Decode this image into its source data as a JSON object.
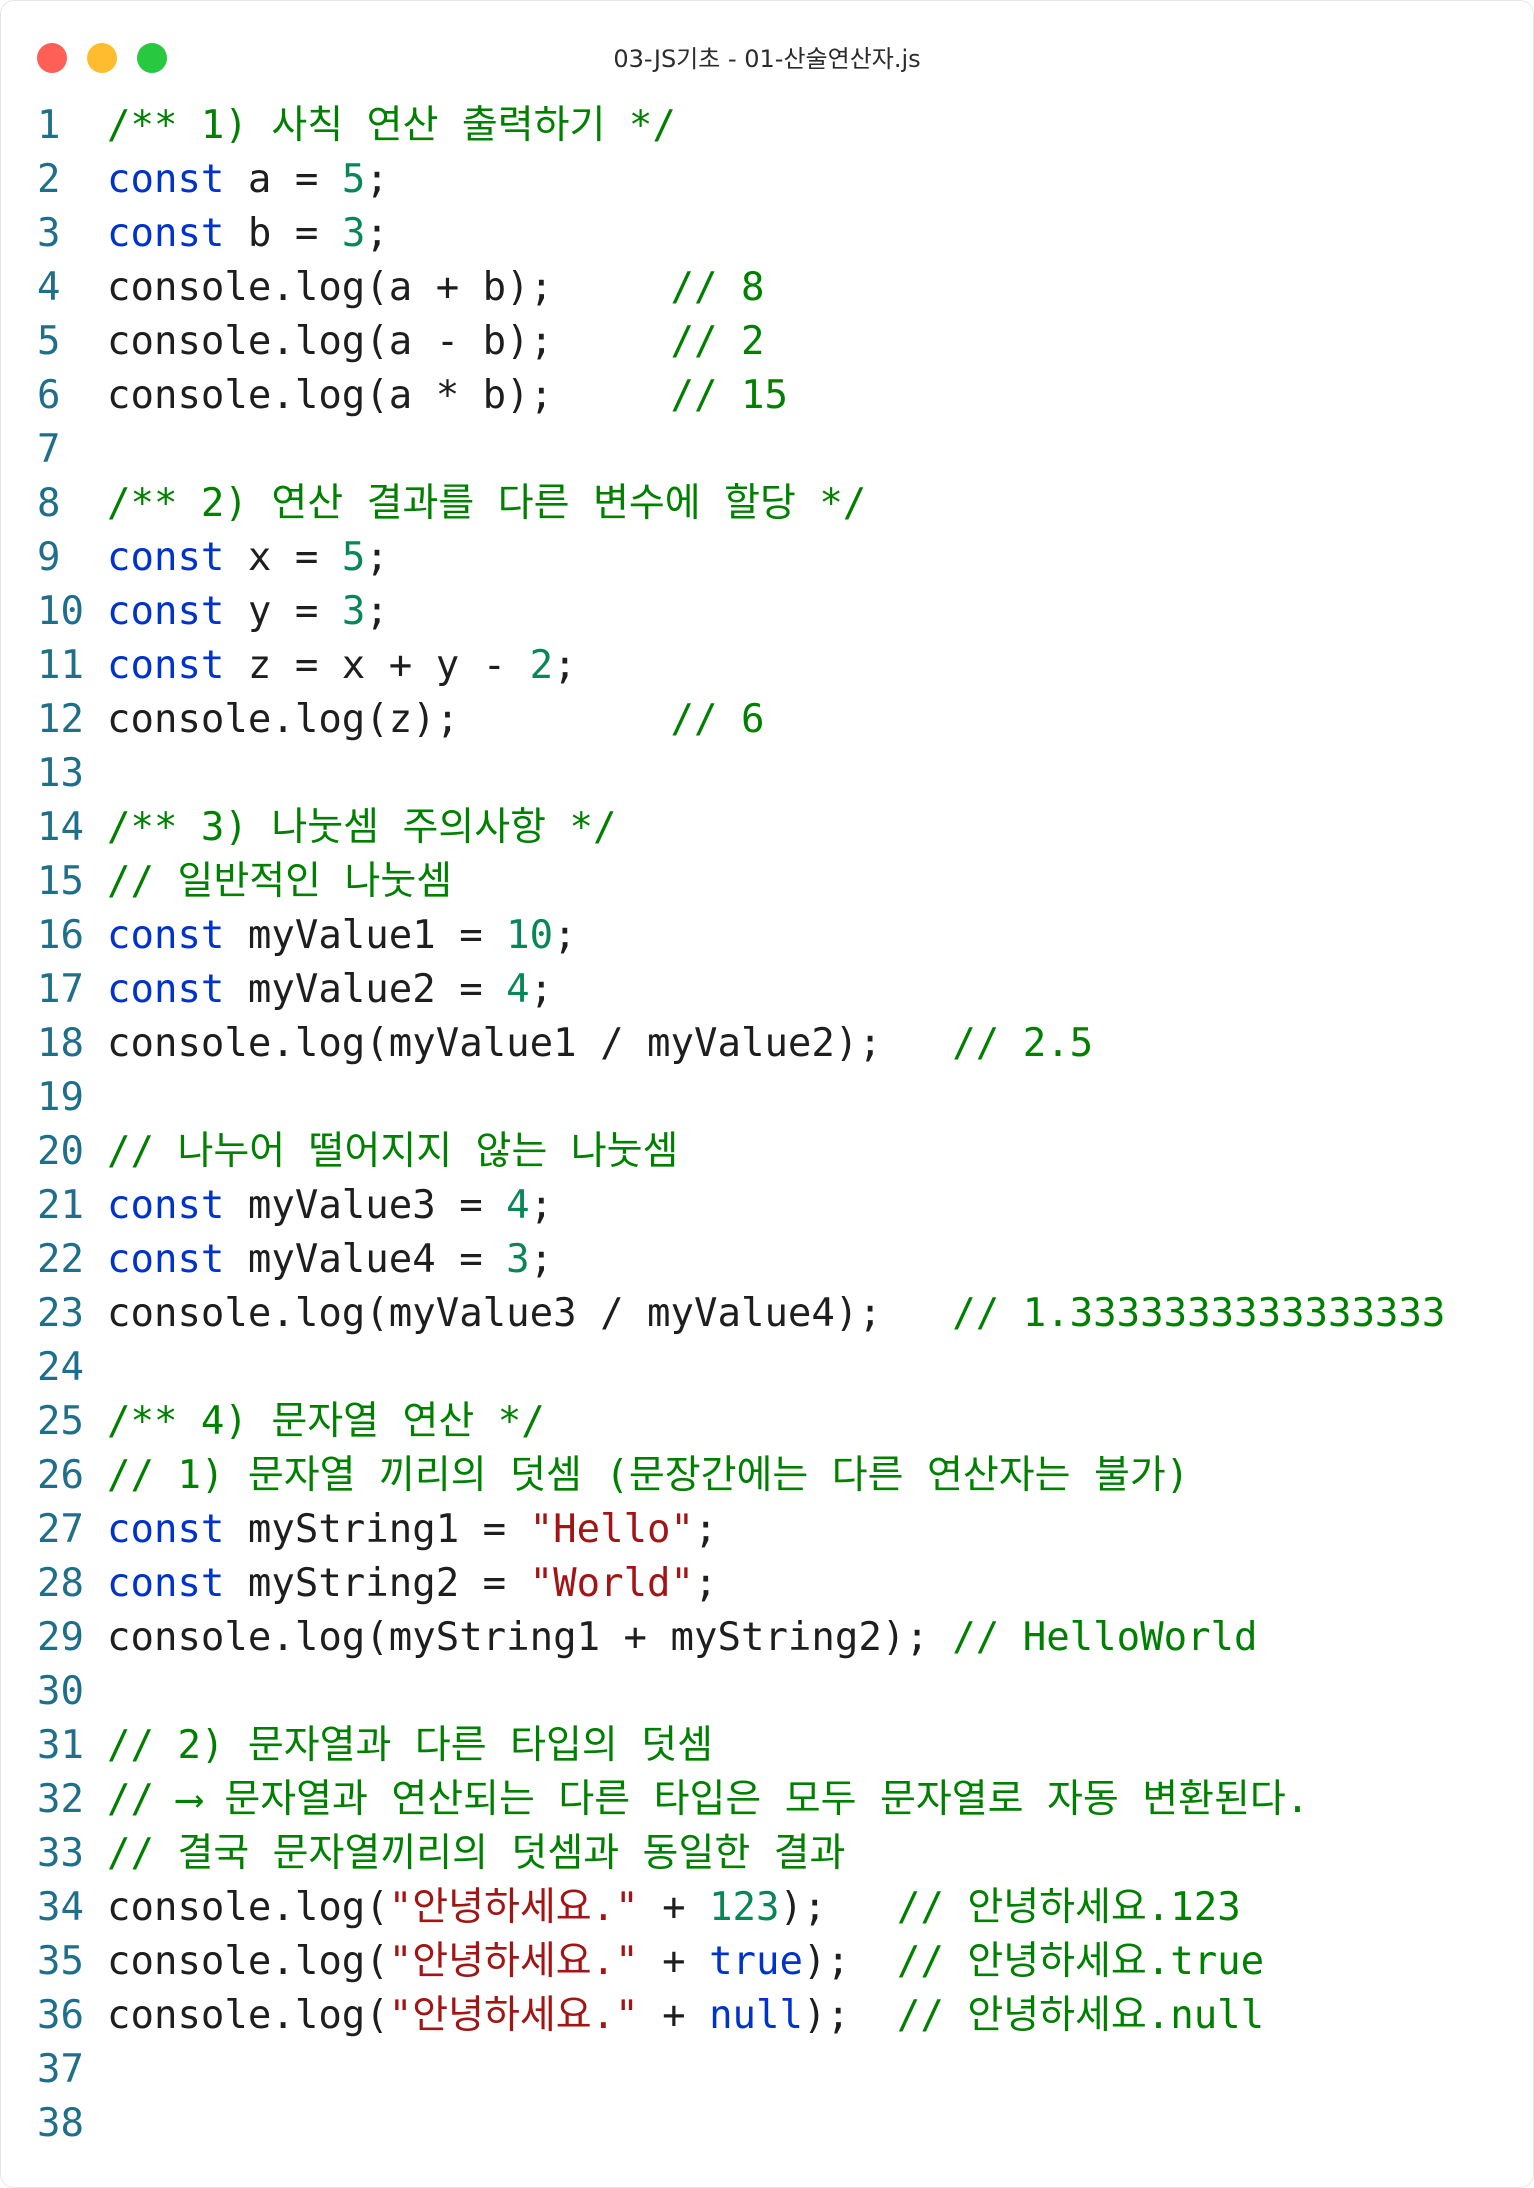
{
  "window": {
    "title": "03-JS기초 - 01-산술연산자.js",
    "controls": [
      "close",
      "minimize",
      "zoom"
    ]
  },
  "code": {
    "lines": [
      {
        "n": "1",
        "tokens": [
          [
            "cm",
            "/** 1) 사칙 연산 출력하기 */"
          ]
        ]
      },
      {
        "n": "2",
        "tokens": [
          [
            "kw",
            "const"
          ],
          [
            "p",
            " a = "
          ],
          [
            "num",
            "5"
          ],
          [
            "p",
            ";"
          ]
        ]
      },
      {
        "n": "3",
        "tokens": [
          [
            "kw",
            "const"
          ],
          [
            "p",
            " b = "
          ],
          [
            "num",
            "3"
          ],
          [
            "p",
            ";"
          ]
        ]
      },
      {
        "n": "4",
        "tokens": [
          [
            "p",
            "console.log(a + b);     "
          ],
          [
            "cm",
            "// 8"
          ]
        ]
      },
      {
        "n": "5",
        "tokens": [
          [
            "p",
            "console.log(a - b);     "
          ],
          [
            "cm",
            "// 2"
          ]
        ]
      },
      {
        "n": "6",
        "tokens": [
          [
            "p",
            "console.log(a * b);     "
          ],
          [
            "cm",
            "// 15"
          ]
        ]
      },
      {
        "n": "7",
        "tokens": []
      },
      {
        "n": "8",
        "tokens": [
          [
            "cm",
            "/** 2) 연산 결과를 다른 변수에 할당 */"
          ]
        ]
      },
      {
        "n": "9",
        "tokens": [
          [
            "kw",
            "const"
          ],
          [
            "p",
            " x = "
          ],
          [
            "num",
            "5"
          ],
          [
            "p",
            ";"
          ]
        ]
      },
      {
        "n": "10",
        "tokens": [
          [
            "kw",
            "const"
          ],
          [
            "p",
            " y = "
          ],
          [
            "num",
            "3"
          ],
          [
            "p",
            ";"
          ]
        ]
      },
      {
        "n": "11",
        "tokens": [
          [
            "kw",
            "const"
          ],
          [
            "p",
            " z = x + y - "
          ],
          [
            "num",
            "2"
          ],
          [
            "p",
            ";"
          ]
        ]
      },
      {
        "n": "12",
        "tokens": [
          [
            "p",
            "console.log(z);         "
          ],
          [
            "cm",
            "// 6"
          ]
        ]
      },
      {
        "n": "13",
        "tokens": []
      },
      {
        "n": "14",
        "tokens": [
          [
            "cm",
            "/** 3) 나눗셈 주의사항 */"
          ]
        ]
      },
      {
        "n": "15",
        "tokens": [
          [
            "cm",
            "// 일반적인 나눗셈"
          ]
        ]
      },
      {
        "n": "16",
        "tokens": [
          [
            "kw",
            "const"
          ],
          [
            "p",
            " myValue1 = "
          ],
          [
            "num",
            "10"
          ],
          [
            "p",
            ";"
          ]
        ]
      },
      {
        "n": "17",
        "tokens": [
          [
            "kw",
            "const"
          ],
          [
            "p",
            " myValue2 = "
          ],
          [
            "num",
            "4"
          ],
          [
            "p",
            ";"
          ]
        ]
      },
      {
        "n": "18",
        "tokens": [
          [
            "p",
            "console.log(myValue1 / myValue2);   "
          ],
          [
            "cm",
            "// 2.5"
          ]
        ]
      },
      {
        "n": "19",
        "tokens": []
      },
      {
        "n": "20",
        "tokens": [
          [
            "cm",
            "// 나누어 떨어지지 않는 나눗셈"
          ]
        ]
      },
      {
        "n": "21",
        "tokens": [
          [
            "kw",
            "const"
          ],
          [
            "p",
            " myValue3 = "
          ],
          [
            "num",
            "4"
          ],
          [
            "p",
            ";"
          ]
        ]
      },
      {
        "n": "22",
        "tokens": [
          [
            "kw",
            "const"
          ],
          [
            "p",
            " myValue4 = "
          ],
          [
            "num",
            "3"
          ],
          [
            "p",
            ";"
          ]
        ]
      },
      {
        "n": "23",
        "tokens": [
          [
            "p",
            "console.log(myValue3 / myValue4);   "
          ],
          [
            "cm",
            "// 1.3333333333333333"
          ]
        ]
      },
      {
        "n": "24",
        "tokens": []
      },
      {
        "n": "25",
        "tokens": [
          [
            "cm",
            "/** 4) 문자열 연산 */"
          ]
        ]
      },
      {
        "n": "26",
        "tokens": [
          [
            "cm",
            "// 1) 문자열 끼리의 덧셈 (문장간에는 다른 연산자는 불가)"
          ]
        ]
      },
      {
        "n": "27",
        "tokens": [
          [
            "kw",
            "const"
          ],
          [
            "p",
            " myString1 = "
          ],
          [
            "str",
            "\"Hello\""
          ],
          [
            "p",
            ";"
          ]
        ]
      },
      {
        "n": "28",
        "tokens": [
          [
            "kw",
            "const"
          ],
          [
            "p",
            " myString2 = "
          ],
          [
            "str",
            "\"World\""
          ],
          [
            "p",
            ";"
          ]
        ]
      },
      {
        "n": "29",
        "tokens": [
          [
            "p",
            "console.log(myString1 + myString2); "
          ],
          [
            "cm",
            "// HelloWorld"
          ]
        ]
      },
      {
        "n": "30",
        "tokens": []
      },
      {
        "n": "31",
        "tokens": [
          [
            "cm",
            "// 2) 문자열과 다른 타입의 덧셈"
          ]
        ]
      },
      {
        "n": "32",
        "tokens": [
          [
            "cm",
            "// ⟶ 문자열과 연산되는 다른 타입은 모두 문자열로 자동 변환된다."
          ]
        ]
      },
      {
        "n": "33",
        "tokens": [
          [
            "cm",
            "// 결국 문자열끼리의 덧셈과 동일한 결과"
          ]
        ]
      },
      {
        "n": "34",
        "tokens": [
          [
            "p",
            "console.log("
          ],
          [
            "str",
            "\"안녕하세요.\""
          ],
          [
            "p",
            " + "
          ],
          [
            "num",
            "123"
          ],
          [
            "p",
            ");   "
          ],
          [
            "cm",
            "// 안녕하세요.123"
          ]
        ]
      },
      {
        "n": "35",
        "tokens": [
          [
            "p",
            "console.log("
          ],
          [
            "str",
            "\"안녕하세요.\""
          ],
          [
            "p",
            " + "
          ],
          [
            "kw",
            "true"
          ],
          [
            "p",
            ");  "
          ],
          [
            "cm",
            "// 안녕하세요.true"
          ]
        ]
      },
      {
        "n": "36",
        "tokens": [
          [
            "p",
            "console.log("
          ],
          [
            "str",
            "\"안녕하세요.\""
          ],
          [
            "p",
            " + "
          ],
          [
            "kw",
            "null"
          ],
          [
            "p",
            ");  "
          ],
          [
            "cm",
            "// 안녕하세요.null"
          ]
        ]
      },
      {
        "n": "37",
        "tokens": []
      },
      {
        "n": "38",
        "tokens": []
      }
    ]
  }
}
